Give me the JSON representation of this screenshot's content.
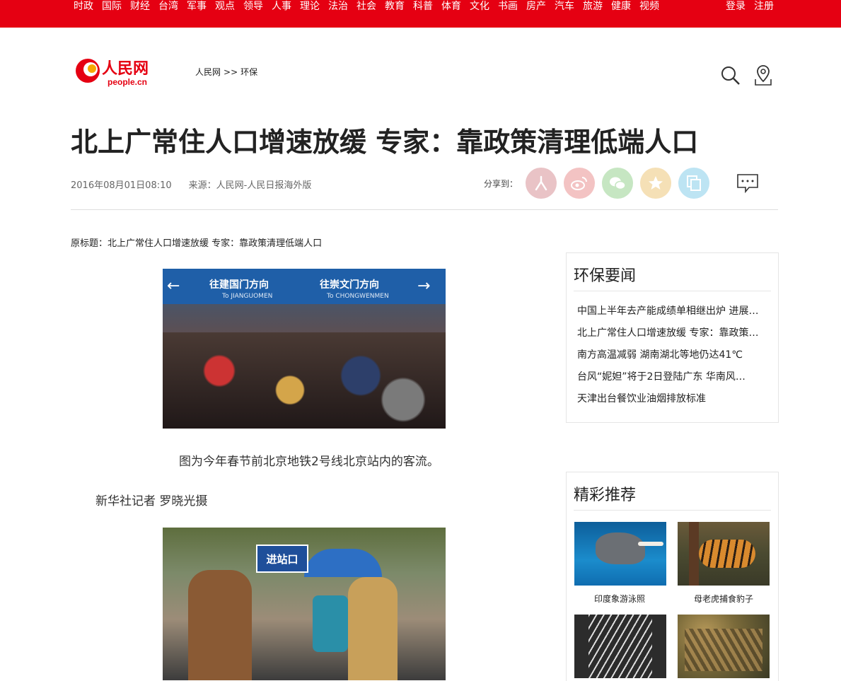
{
  "topnav": {
    "items": [
      "时政",
      "国际",
      "财经",
      "台湾",
      "军事",
      "观点",
      "领导",
      "人事",
      "理论",
      "法治",
      "社会",
      "教育",
      "科普",
      "体育",
      "文化",
      "书画",
      "房产",
      "汽车",
      "旅游",
      "健康",
      "视频"
    ],
    "login": "登录",
    "register": "注册",
    "bg_color": "#e50012"
  },
  "header": {
    "logo_text": "人民网",
    "logo_sub": "people.cn",
    "breadcrumb": [
      "人民网",
      ">>",
      "环保"
    ]
  },
  "article": {
    "title": "北上广常住人口增速放缓 专家：靠政策清理低端人口",
    "date": "2016年08月01日08:10",
    "source": "来源：人民网-人民日报海外版",
    "share_label": "分享到：",
    "original_title": "原标题：北上广常住人口增速放缓 专家：靠政策清理低端人口",
    "photo1_sign_left": "往建国门方向",
    "photo1_sign_left_en": "To JIANGUOMEN",
    "photo1_sign_right": "往崇文门方向",
    "photo1_sign_right_en": "To CHONGWENMEN",
    "caption1": "图为今年春节前北京地铁2号线北京站内的客流。",
    "caption2": "新华社记者 罗晓光摄",
    "photo2_sign": "进站口"
  },
  "sidebar": {
    "env_news": {
      "title": "环保要闻",
      "items": [
        "中国上半年去产能成绩单相继出炉 进展…",
        "北上广常住人口增速放缓 专家：靠政策…",
        "南方高温减弱 湖南湖北等地仍达41℃",
        "台风“妮妲”将于2日登陆广东 华南风…",
        "天津出台餐饮业油烟排放标准"
      ]
    },
    "recommend": {
      "title": "精彩推荐",
      "items": [
        {
          "caption": "印度象游泳照"
        },
        {
          "caption": "母老虎捕食豹子"
        }
      ]
    }
  }
}
